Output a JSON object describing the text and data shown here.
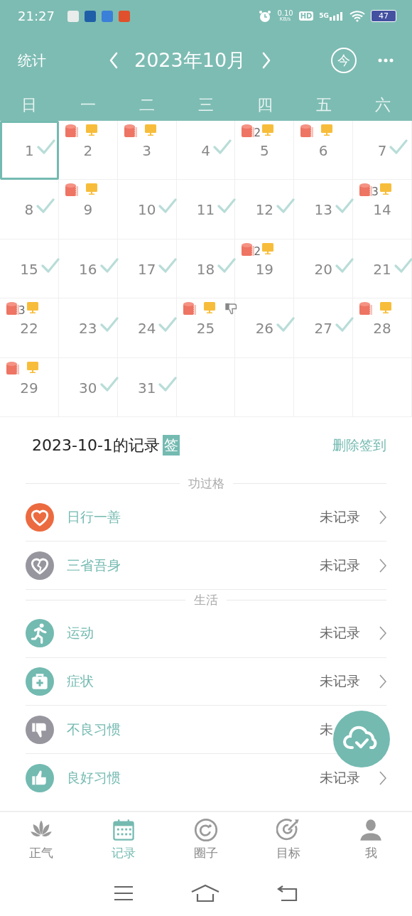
{
  "status_bar": {
    "time": "21:27",
    "apps": [
      {
        "color": "#e8ecea"
      },
      {
        "color": "#1f5fa8"
      },
      {
        "color": "#3a7fd8"
      },
      {
        "color": "#e0502c"
      }
    ],
    "speed": "0.10",
    "speed_unit": "KB/s",
    "hd": "HD",
    "network": "5G",
    "battery": "47"
  },
  "header": {
    "left": "统计",
    "month": "2023年10月",
    "today": "今"
  },
  "weekdays": [
    "日",
    "一",
    "二",
    "三",
    "四",
    "五",
    "六"
  ],
  "calendar": {
    "days": [
      {
        "day": "1",
        "checked": true,
        "selected": true
      },
      {
        "day": "2",
        "checked": false,
        "selected": false,
        "marks": [
          {
            "kind": "book"
          },
          {
            "kind": "screen"
          }
        ]
      },
      {
        "day": "3",
        "checked": false,
        "selected": false,
        "marks": [
          {
            "kind": "book"
          },
          {
            "kind": "screen"
          }
        ]
      },
      {
        "day": "4",
        "checked": true,
        "selected": false
      },
      {
        "day": "5",
        "checked": false,
        "selected": false,
        "marks": [
          {
            "kind": "book",
            "count": "2"
          },
          {
            "kind": "screen"
          }
        ]
      },
      {
        "day": "6",
        "checked": false,
        "selected": false,
        "marks": [
          {
            "kind": "book"
          },
          {
            "kind": "screen"
          }
        ]
      },
      {
        "day": "7",
        "checked": true,
        "selected": false
      },
      {
        "day": "8",
        "checked": true,
        "selected": false
      },
      {
        "day": "9",
        "checked": false,
        "selected": false,
        "marks": [
          {
            "kind": "book"
          },
          {
            "kind": "screen"
          }
        ]
      },
      {
        "day": "10",
        "checked": true,
        "selected": false
      },
      {
        "day": "11",
        "checked": true,
        "selected": false
      },
      {
        "day": "12",
        "checked": true,
        "selected": false
      },
      {
        "day": "13",
        "checked": true,
        "selected": false
      },
      {
        "day": "14",
        "checked": false,
        "selected": false,
        "marks": [
          {
            "kind": "book",
            "count": "3"
          },
          {
            "kind": "screen"
          }
        ]
      },
      {
        "day": "15",
        "checked": true,
        "selected": false
      },
      {
        "day": "16",
        "checked": true,
        "selected": false
      },
      {
        "day": "17",
        "checked": true,
        "selected": false
      },
      {
        "day": "18",
        "checked": true,
        "selected": false
      },
      {
        "day": "19",
        "checked": false,
        "selected": false,
        "marks": [
          {
            "kind": "book",
            "count": "2"
          },
          {
            "kind": "screen"
          }
        ]
      },
      {
        "day": "20",
        "checked": true,
        "selected": false
      },
      {
        "day": "21",
        "checked": true,
        "selected": false
      },
      {
        "day": "22",
        "checked": false,
        "selected": false,
        "marks": [
          {
            "kind": "book",
            "count": "3"
          },
          {
            "kind": "screen"
          }
        ]
      },
      {
        "day": "23",
        "checked": true,
        "selected": false
      },
      {
        "day": "24",
        "checked": true,
        "selected": false
      },
      {
        "day": "25",
        "checked": false,
        "selected": false,
        "marks": [
          {
            "kind": "book"
          },
          {
            "kind": "screen"
          },
          {
            "kind": "dislike"
          }
        ]
      },
      {
        "day": "26",
        "checked": true,
        "selected": false
      },
      {
        "day": "27",
        "checked": true,
        "selected": false
      },
      {
        "day": "28",
        "checked": false,
        "selected": false,
        "marks": [
          {
            "kind": "book"
          },
          {
            "kind": "screen"
          }
        ]
      },
      {
        "day": "29",
        "checked": false,
        "selected": false,
        "marks": [
          {
            "kind": "book"
          },
          {
            "kind": "screen"
          }
        ]
      },
      {
        "day": "30",
        "checked": true,
        "selected": false
      },
      {
        "day": "31",
        "checked": true,
        "selected": false
      }
    ]
  },
  "records": {
    "title": "2023-10-1的记录",
    "badge": "签",
    "action": "删除签到",
    "groups": [
      {
        "title": "功过格",
        "items": [
          {
            "label": "日行一善",
            "status": "未记录",
            "color": "#ec6a3f"
          },
          {
            "label": "三省吾身",
            "status": "未记录",
            "color": "#97969e"
          }
        ]
      },
      {
        "title": "生活",
        "items": [
          {
            "label": "运动",
            "status": "未记录",
            "color": "#73bab1"
          },
          {
            "label": "症状",
            "status": "未记录",
            "color": "#73bab1"
          },
          {
            "label": "不良习惯",
            "status": "未",
            "color": "#97969e"
          },
          {
            "label": "良好习惯",
            "status": "未记录",
            "color": "#73bab1"
          }
        ]
      }
    ]
  },
  "tabs": [
    {
      "label": "正气",
      "selected": false
    },
    {
      "label": "记录",
      "selected": true
    },
    {
      "label": "圈子",
      "selected": false
    },
    {
      "label": "目标",
      "selected": false
    },
    {
      "label": "我",
      "selected": false
    }
  ]
}
